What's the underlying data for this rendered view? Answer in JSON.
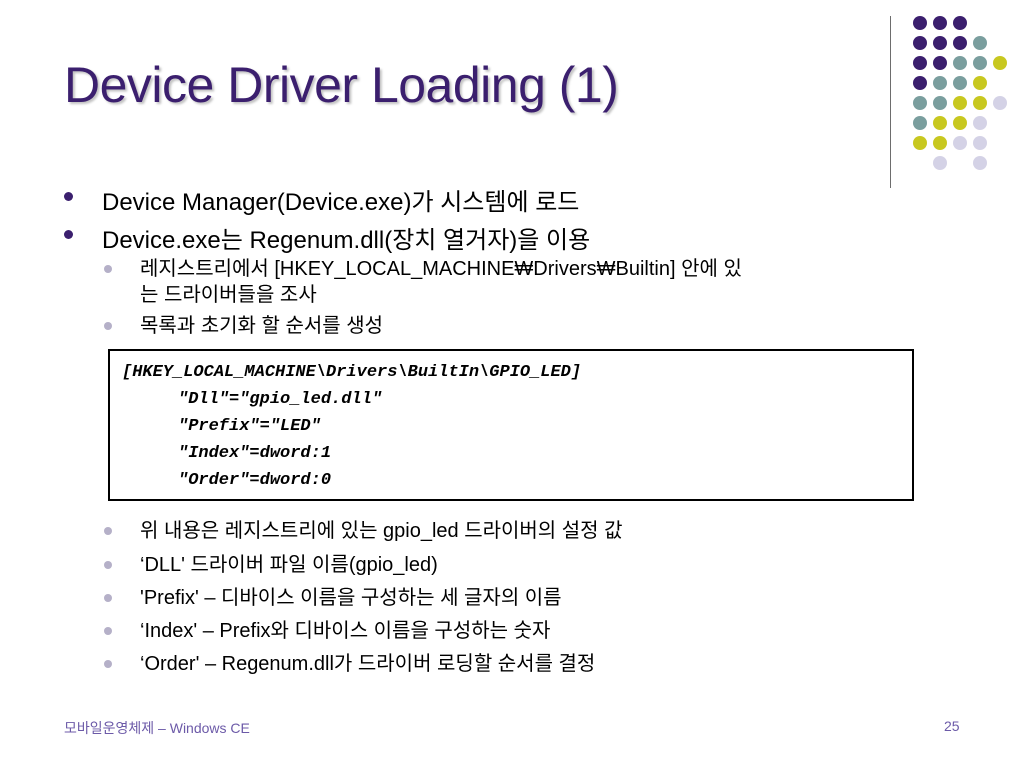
{
  "slide": {
    "title": "Device Driver Loading (1)",
    "bullets": [
      "Device Manager(Device.exe)가 시스템에 로드",
      "Device.exe는 Regenum.dll(장치 열거자)을 이용"
    ],
    "sub_bullets_top": [
      {
        "line1": "레지스트리에서 [HKEY_LOCAL_MACHINE₩Drivers₩Builtin] 안에 있",
        "line2": "는 드라이버들을 조사"
      },
      {
        "line1": "목록과 초기화 할 순서를 생성",
        "line2": ""
      }
    ],
    "code_lines": [
      "[HKEY_LOCAL_MACHINE\\Drivers\\BuiltIn\\GPIO_LED]",
      "\"Dll\"=\"gpio_led.dll\"",
      "\"Prefix\"=\"LED\"",
      "\"Index\"=dword:1",
      "\"Order\"=dword:0"
    ],
    "sub_bullets_bottom": [
      "위 내용은 레지스트리에 있는 gpio_led 드라이버의 설정 값",
      "‘DLL'  드라이버 파일 이름(gpio_led)",
      "'Prefix' – 디바이스 이름을 구성하는 세 글자의 이름",
      "‘Index' – Prefix와 디바이스 이름을 구성하는 숫자",
      "‘Order' – Regenum.dll가 드라이버 로딩할 순서를 결정"
    ],
    "footer_left": "모바일운영체제 – Windows CE",
    "page_number": "25"
  },
  "colors": {
    "title": "#3b1f6e",
    "dot_purple": "#3b1f6e",
    "dot_teal": "#7a9e9e",
    "dot_yellow": "#c8c820",
    "dot_lavender": "#d4d2e6",
    "footer": "#6c5aa8"
  }
}
